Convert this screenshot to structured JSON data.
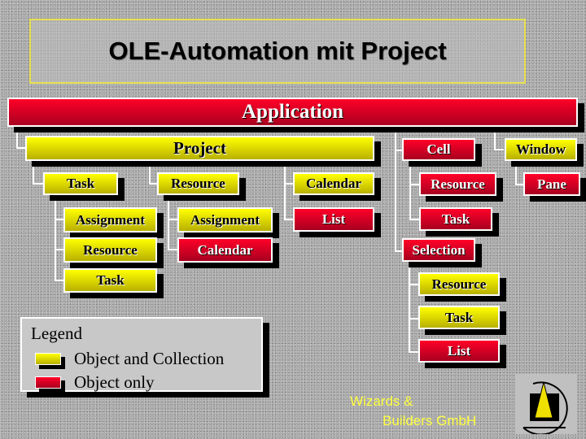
{
  "title": "OLE-Automation mit Project",
  "colors": {
    "object_and_collection": "#ffff00",
    "object_only": "#e0002a",
    "connector": "#ffffff"
  },
  "nodes": {
    "application": {
      "label": "Application",
      "type": "object_only"
    },
    "project": {
      "label": "Project",
      "type": "object_and_collection"
    },
    "cell": {
      "label": "Cell",
      "type": "object_only"
    },
    "window": {
      "label": "Window",
      "type": "object_and_collection"
    },
    "project_task": {
      "label": "Task",
      "type": "object_and_collection"
    },
    "project_resource": {
      "label": "Resource",
      "type": "object_and_collection"
    },
    "project_calendar": {
      "label": "Calendar",
      "type": "object_and_collection"
    },
    "project_list": {
      "label": "List",
      "type": "object_only"
    },
    "task_assignment": {
      "label": "Assignment",
      "type": "object_and_collection"
    },
    "task_resource": {
      "label": "Resource",
      "type": "object_and_collection"
    },
    "task_task": {
      "label": "Task",
      "type": "object_and_collection"
    },
    "resource_assignment": {
      "label": "Assignment",
      "type": "object_and_collection"
    },
    "resource_calendar": {
      "label": "Calendar",
      "type": "object_only"
    },
    "cell_resource": {
      "label": "Resource",
      "type": "object_only"
    },
    "cell_task": {
      "label": "Task",
      "type": "object_only"
    },
    "selection": {
      "label": "Selection",
      "type": "object_only"
    },
    "selection_resource": {
      "label": "Resource",
      "type": "object_and_collection"
    },
    "selection_task": {
      "label": "Task",
      "type": "object_and_collection"
    },
    "selection_list": {
      "label": "List",
      "type": "object_only"
    },
    "window_pane": {
      "label": "Pane",
      "type": "object_only"
    }
  },
  "legend": {
    "title": "Legend",
    "items": [
      {
        "label": "Object and Collection",
        "type": "object_and_collection"
      },
      {
        "label": "Object only",
        "type": "object_only"
      }
    ]
  },
  "company": {
    "line1": "Wizards &",
    "line2": "Builders GmbH"
  }
}
